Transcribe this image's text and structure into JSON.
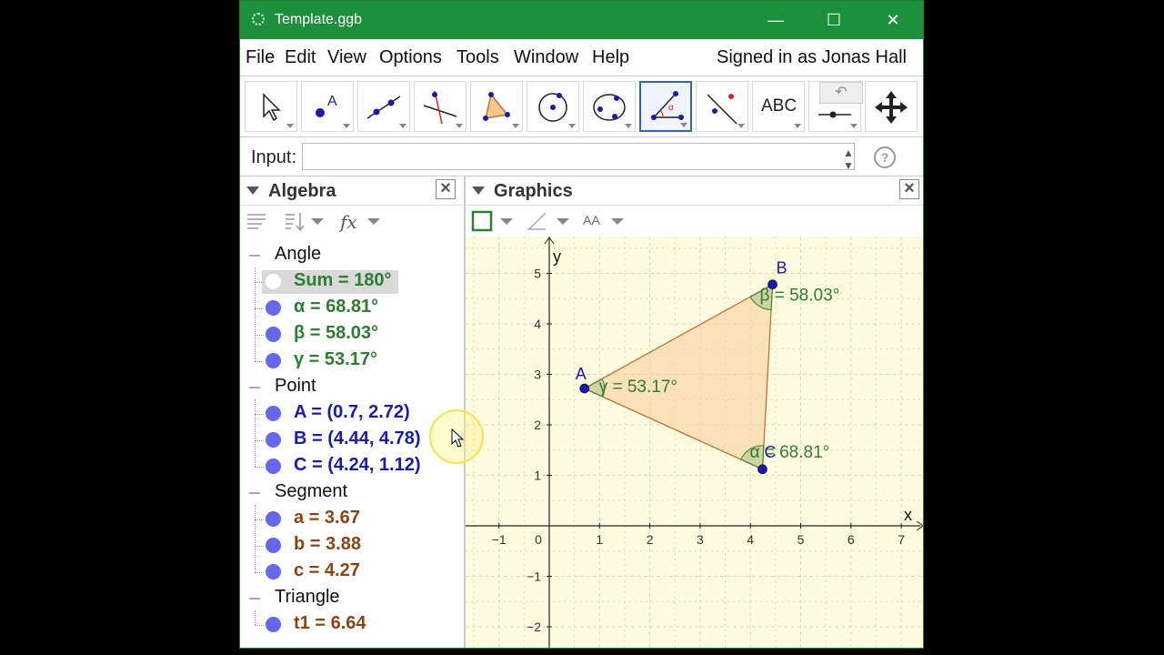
{
  "window": {
    "title": "Template.ggb",
    "minimize": "—",
    "maximize": "☐",
    "close": "✕"
  },
  "menu": {
    "items": [
      "File",
      "Edit",
      "View",
      "Options",
      "Tools",
      "Window",
      "Help"
    ],
    "signed_in": "Signed in as Jonas Hall"
  },
  "toolbar": {
    "text_tool": "ABC",
    "selected_tool": "angle-tool"
  },
  "input": {
    "label": "Input:",
    "value": "",
    "help": "?"
  },
  "algebra": {
    "title": "Algebra",
    "categories": [
      {
        "name": "Angle",
        "items": [
          {
            "text": "Sum = 180°",
            "color": "#2e7d32",
            "hidden": true
          },
          {
            "text": "α = 68.81°",
            "color": "#2e7d32"
          },
          {
            "text": "β = 58.03°",
            "color": "#2e7d32"
          },
          {
            "text": "γ = 53.17°",
            "color": "#2e7d32"
          }
        ]
      },
      {
        "name": "Point",
        "items": [
          {
            "text": "A = (0.7, 2.72)",
            "color": "#1a1ab0"
          },
          {
            "text": "B = (4.44, 4.78)",
            "color": "#1a1ab0"
          },
          {
            "text": "C = (4.24, 1.12)",
            "color": "#1a1ab0"
          }
        ]
      },
      {
        "name": "Segment",
        "items": [
          {
            "text": "a = 3.67",
            "color": "#8b4513"
          },
          {
            "text": "b = 3.88",
            "color": "#8b4513"
          },
          {
            "text": "c = 4.27",
            "color": "#8b4513"
          }
        ]
      },
      {
        "name": "Triangle",
        "items": [
          {
            "text": "t1 = 6.64",
            "color": "#8b4513"
          }
        ]
      }
    ]
  },
  "graphics": {
    "title": "Graphics",
    "style_label": "AA",
    "axis_x_label": "x",
    "axis_y_label": "y",
    "x_ticks": [
      -1,
      0,
      1,
      2,
      3,
      4,
      5,
      6,
      7
    ],
    "y_ticks": [
      -2,
      -1,
      1,
      2,
      3,
      4,
      5
    ],
    "points": [
      {
        "name": "A",
        "x": 0.7,
        "y": 2.72
      },
      {
        "name": "B",
        "x": 4.44,
        "y": 4.78
      },
      {
        "name": "C",
        "x": 4.24,
        "y": 1.12
      }
    ],
    "angle_labels": {
      "alpha": "α = 68.81°",
      "beta": "β = 58.03°",
      "gamma": "γ = 53.17°"
    },
    "colors": {
      "point": "#1a1ab0",
      "triangle_fill": "#f5d29b",
      "triangle_stroke": "#b8743a",
      "angle_text": "#2e7d32",
      "grid": "#d9d7c0",
      "background": "#fefbe1"
    }
  }
}
